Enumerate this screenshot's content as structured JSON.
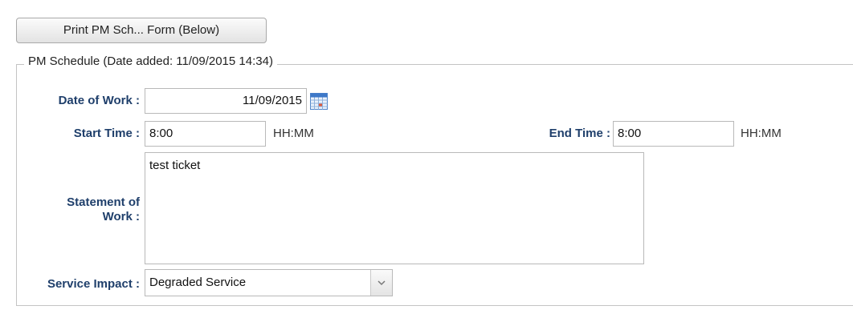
{
  "print_button": {
    "label": "Print PM Sch... Form (Below)"
  },
  "section": {
    "legend": "PM Schedule (Date added: 11/09/2015 14:34)"
  },
  "form": {
    "date_of_work": {
      "label": "Date of Work :",
      "value": "11/09/2015",
      "icon": "calendar-icon"
    },
    "start_time": {
      "label": "Start Time :",
      "value": "8:00",
      "hint": "HH:MM"
    },
    "end_time": {
      "label": "End Time :",
      "value": "8:00",
      "hint": "HH:MM"
    },
    "statement_of_work": {
      "label_line1": "Statement of",
      "label_line2": "Work :",
      "value": "test ticket"
    },
    "service_impact": {
      "label": "Service Impact :",
      "value": "Degraded Service",
      "icon": "chevron-down-icon"
    }
  }
}
